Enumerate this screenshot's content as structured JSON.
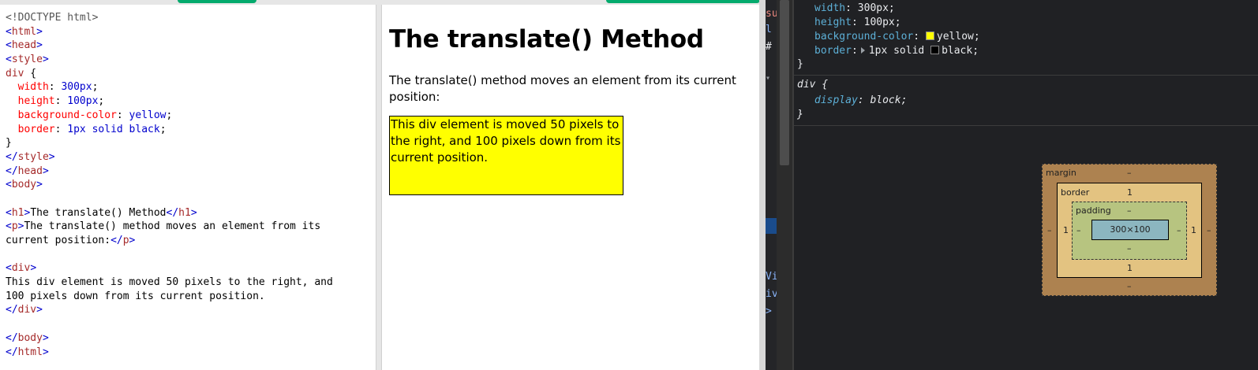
{
  "editor": {
    "lines": [
      [
        {
          "c": "dim",
          "t": "<!DOCTYPE html>"
        }
      ],
      [
        {
          "c": "br",
          "t": "<"
        },
        {
          "c": "tag",
          "t": "html"
        },
        {
          "c": "br",
          "t": ">"
        }
      ],
      [
        {
          "c": "br",
          "t": "<"
        },
        {
          "c": "tag",
          "t": "head"
        },
        {
          "c": "br",
          "t": ">"
        }
      ],
      [
        {
          "c": "br",
          "t": "<"
        },
        {
          "c": "tag",
          "t": "style"
        },
        {
          "c": "br",
          "t": ">"
        }
      ],
      [
        {
          "c": "tag",
          "t": "div"
        },
        {
          "c": "",
          "t": " {"
        }
      ],
      [
        {
          "c": "",
          "t": "  "
        },
        {
          "c": "prop",
          "t": "width"
        },
        {
          "c": "",
          "t": ": "
        },
        {
          "c": "val",
          "t": "300px"
        },
        {
          "c": "",
          "t": ";"
        }
      ],
      [
        {
          "c": "",
          "t": "  "
        },
        {
          "c": "prop",
          "t": "height"
        },
        {
          "c": "",
          "t": ": "
        },
        {
          "c": "val",
          "t": "100px"
        },
        {
          "c": "",
          "t": ";"
        }
      ],
      [
        {
          "c": "",
          "t": "  "
        },
        {
          "c": "prop",
          "t": "background-color"
        },
        {
          "c": "",
          "t": ": "
        },
        {
          "c": "val",
          "t": "yellow"
        },
        {
          "c": "",
          "t": ";"
        }
      ],
      [
        {
          "c": "",
          "t": "  "
        },
        {
          "c": "prop",
          "t": "border"
        },
        {
          "c": "",
          "t": ": "
        },
        {
          "c": "val",
          "t": "1px solid black"
        },
        {
          "c": "",
          "t": ";"
        }
      ],
      [
        {
          "c": "",
          "t": "}"
        }
      ],
      [
        {
          "c": "br",
          "t": "</"
        },
        {
          "c": "tag",
          "t": "style"
        },
        {
          "c": "br",
          "t": ">"
        }
      ],
      [
        {
          "c": "br",
          "t": "</"
        },
        {
          "c": "tag",
          "t": "head"
        },
        {
          "c": "br",
          "t": ">"
        }
      ],
      [
        {
          "c": "br",
          "t": "<"
        },
        {
          "c": "tag",
          "t": "body"
        },
        {
          "c": "br",
          "t": ">"
        }
      ],
      [
        {
          "c": "",
          "t": ""
        }
      ],
      [
        {
          "c": "br",
          "t": "<"
        },
        {
          "c": "tag",
          "t": "h1"
        },
        {
          "c": "br",
          "t": ">"
        },
        {
          "c": "",
          "t": "The translate() Method"
        },
        {
          "c": "br",
          "t": "</"
        },
        {
          "c": "tag",
          "t": "h1"
        },
        {
          "c": "br",
          "t": ">"
        }
      ],
      [
        {
          "c": "br",
          "t": "<"
        },
        {
          "c": "tag",
          "t": "p"
        },
        {
          "c": "br",
          "t": ">"
        },
        {
          "c": "",
          "t": "The translate() method moves an element from its"
        }
      ],
      [
        {
          "c": "",
          "t": "current position:"
        },
        {
          "c": "br",
          "t": "</"
        },
        {
          "c": "tag",
          "t": "p"
        },
        {
          "c": "br",
          "t": ">"
        }
      ],
      [
        {
          "c": "",
          "t": ""
        }
      ],
      [
        {
          "c": "br",
          "t": "<"
        },
        {
          "c": "tag",
          "t": "div"
        },
        {
          "c": "br",
          "t": ">"
        }
      ],
      [
        {
          "c": "",
          "t": "This div element is moved 50 pixels to the right, and"
        }
      ],
      [
        {
          "c": "",
          "t": "100 pixels down from its current position."
        }
      ],
      [
        {
          "c": "br",
          "t": "</"
        },
        {
          "c": "tag",
          "t": "div"
        },
        {
          "c": "br",
          "t": ">"
        }
      ],
      [
        {
          "c": "",
          "t": ""
        }
      ],
      [
        {
          "c": "br",
          "t": "</"
        },
        {
          "c": "tag",
          "t": "body"
        },
        {
          "c": "br",
          "t": ">"
        }
      ],
      [
        {
          "c": "br",
          "t": "</"
        },
        {
          "c": "tag",
          "t": "html"
        },
        {
          "c": "br",
          "t": ">"
        }
      ]
    ]
  },
  "result": {
    "heading": "The translate() Method",
    "paragraph": "The translate() method moves an element from its current position:",
    "div_text": "This div element is moved 50 pixels to the right, and 100 pixels down from its current position."
  },
  "devtools": {
    "gutter": [
      "su",
      "l",
      "#",
      "▾",
      "Vi",
      "iv",
      ">"
    ],
    "author_rule": {
      "width_prop": "width",
      "width_val": "300px;",
      "height_prop": "height",
      "height_val": "100px;",
      "bg_prop": "background-color",
      "bg_val": "yellow;",
      "bg_swatch": "#ffff00",
      "border_prop": "border",
      "border_val": "1px solid",
      "border_color": "black;",
      "border_swatch": "#000000",
      "close": "}"
    },
    "ua_rule": {
      "selector": "div {",
      "prop": "display",
      "val": "block;",
      "close": "}"
    },
    "box_model": {
      "margin_label": "margin",
      "margin_top": "–",
      "margin_bottom": "–",
      "margin_left": "–",
      "margin_right": "–",
      "border_label": "border",
      "border_top": "1",
      "border_bottom": "1",
      "border_left": "1",
      "border_right": "1",
      "padding_label": "padding",
      "padding_top": "–",
      "padding_bottom": "–",
      "padding_left": "–",
      "padding_right": "–",
      "content": "300×100"
    }
  },
  "colors": {
    "accent_green": "#04aa6d",
    "devtools_bg": "#202124",
    "prop_color": "#5db0d7",
    "box_margin": "#ad8250",
    "box_border": "#e3c381",
    "box_padding": "#b7c480",
    "box_content": "#8cb6c0"
  }
}
